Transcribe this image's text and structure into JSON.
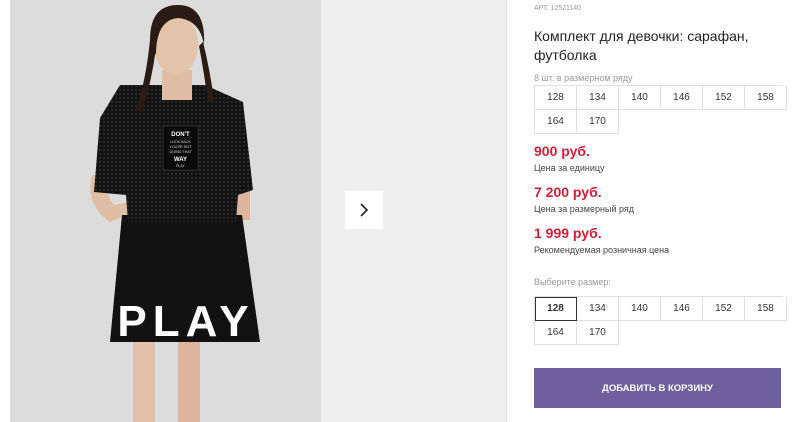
{
  "product": {
    "article_label": "АРТ.",
    "article": "12521140",
    "title": "Комплект для девочки: сарафан, футболка",
    "pack_note": "8 шт. в размерном ряду",
    "pack_sizes": [
      "128",
      "134",
      "140",
      "146",
      "152",
      "158",
      "164",
      "170"
    ],
    "prices": [
      {
        "value": "900 руб.",
        "label": "Цена за единицу"
      },
      {
        "value": "7 200 руб.",
        "label": "Цена за размерный ряд"
      },
      {
        "value": "1 999 руб.",
        "label": "Рекомендуемая розничная цена"
      }
    ],
    "choose_size_label": "Выберите размер:",
    "size_options": [
      "128",
      "134",
      "140",
      "146",
      "152",
      "158",
      "164",
      "170"
    ],
    "selected_size": "128",
    "add_to_cart": "ДОБАВИТЬ В КОРЗИНУ"
  },
  "photo": {
    "patch_text": [
      "DON'T",
      "LOOK BACK",
      "YOU'RE NOT",
      "GOING THAT",
      "WAY",
      "PLAY"
    ],
    "skirt_text": "PLAY"
  },
  "colors": {
    "price": "#d31f36",
    "button": "#6f5f9f",
    "border": "#e0e0e0"
  }
}
